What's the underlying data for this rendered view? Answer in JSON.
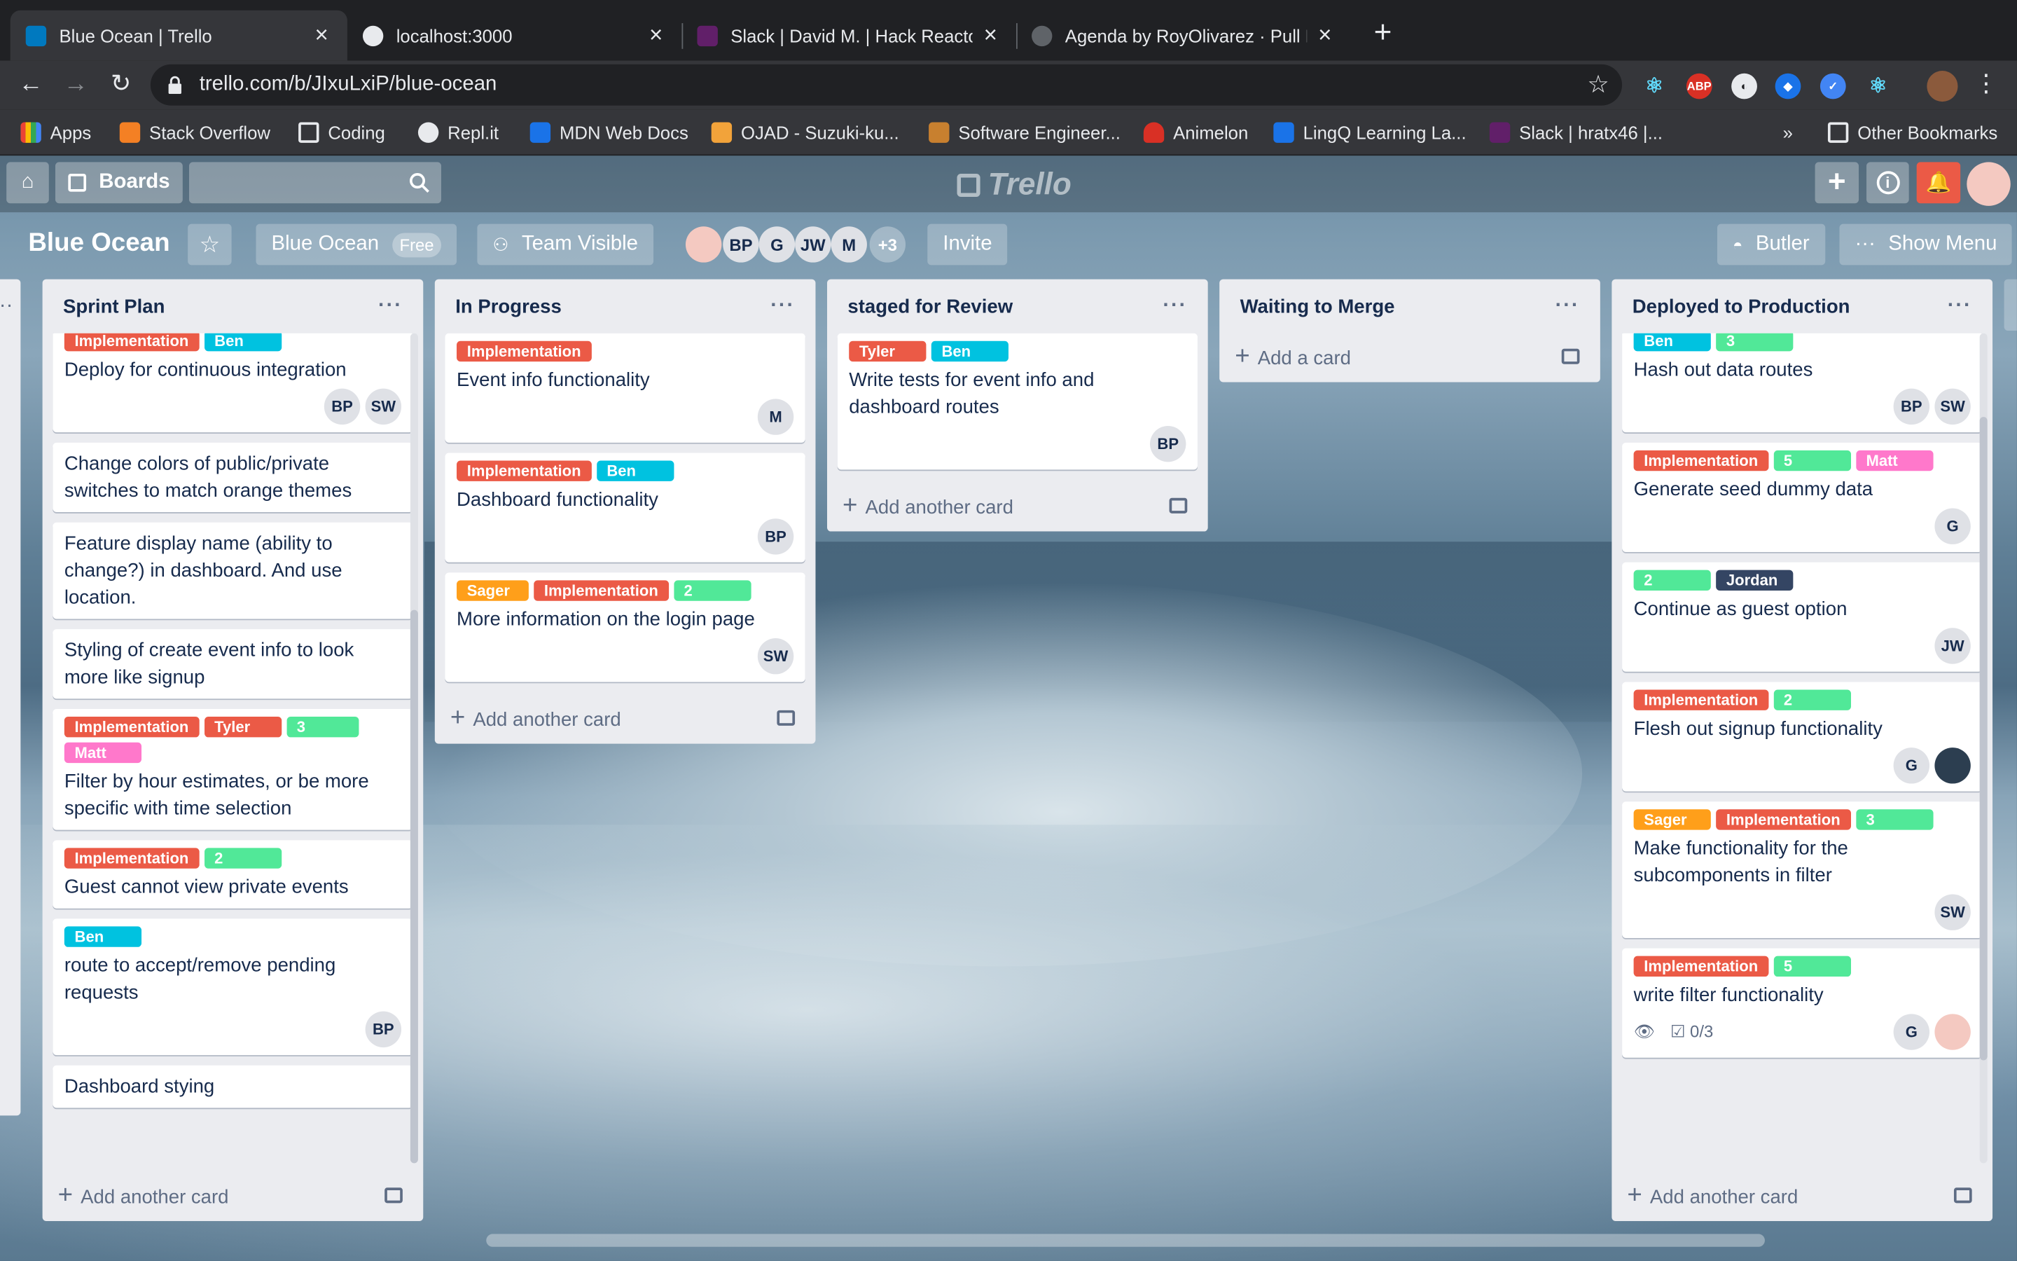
{
  "browser": {
    "tabs": [
      {
        "title": "Blue Ocean | Trello",
        "icon": "trello-icon"
      },
      {
        "title": "localhost:3000",
        "icon": "globe-icon"
      },
      {
        "title": "Slack | David M. | Hack Reactor",
        "icon": "slack-icon"
      },
      {
        "title": "Agenda by RoyOlivarez · Pull Requ",
        "icon": "github-icon"
      }
    ],
    "url": "trello.com/b/JIxuLxiP/blue-ocean",
    "bookmarks": [
      "Apps",
      "Stack Overflow",
      "Coding",
      "Repl.it",
      "MDN Web Docs",
      "OJAD - Suzuki-ku...",
      "Software Engineer...",
      "Animelon",
      "LingQ Learning La...",
      "Slack | hratx46 |...",
      "»",
      "Other Bookmarks"
    ]
  },
  "colors": {
    "red": "#eb5a46",
    "blue": "#00c2e0",
    "green": "#61bd4f",
    "mint": "#51e898",
    "orange": "#ff9f1a",
    "pink": "#ff78cb",
    "navy": "#344563"
  },
  "header": {
    "boards_label": "Boards",
    "logo": "Trello"
  },
  "board": {
    "title": "Blue Ocean",
    "team": "Blue Ocean",
    "team_badge": "Free",
    "visibility": "Team Visible",
    "members": [
      "BP",
      "G",
      "JW",
      "M"
    ],
    "more_members": "+3",
    "invite": "Invite",
    "butler": "Butler",
    "show_menu": "Show Menu"
  },
  "lists": [
    {
      "title": "Sprint Plan",
      "add": "Add another card",
      "cards": [
        {
          "labels": [
            {
              "t": "Implementation",
              "c": "#eb5a46"
            },
            {
              "t": "Ben",
              "c": "#00c2e0"
            }
          ],
          "text": "Deploy for continuous integration",
          "members": [
            "BP",
            "SW"
          ]
        },
        {
          "labels": [],
          "text": "Change colors of public/private switches to match orange themes",
          "members": []
        },
        {
          "labels": [],
          "text": "Feature display name (ability to change?) in dashboard. And use location.",
          "members": []
        },
        {
          "labels": [],
          "text": "Styling of create event info to look more like signup",
          "members": []
        },
        {
          "labels": [
            {
              "t": "Implementation",
              "c": "#eb5a46"
            },
            {
              "t": "Tyler",
              "c": "#eb5a46"
            },
            {
              "t": "3",
              "c": "#51e898"
            },
            {
              "t": "Matt",
              "c": "#ff78cb"
            }
          ],
          "text": "Filter by hour estimates, or be more specific with time selection",
          "members": []
        },
        {
          "labels": [
            {
              "t": "Implementation",
              "c": "#eb5a46"
            },
            {
              "t": "2",
              "c": "#51e898"
            }
          ],
          "text": "Guest cannot view private events",
          "members": []
        },
        {
          "labels": [
            {
              "t": "Ben",
              "c": "#00c2e0"
            }
          ],
          "text": "route to accept/remove pending requests",
          "members": [
            "BP"
          ]
        },
        {
          "labels": [],
          "text": "Dashboard stying",
          "members": []
        }
      ]
    },
    {
      "title": "In Progress",
      "add": "Add another card",
      "cards": [
        {
          "labels": [
            {
              "t": "Implementation",
              "c": "#eb5a46"
            }
          ],
          "text": "Event info functionality",
          "members": [
            "M"
          ]
        },
        {
          "labels": [
            {
              "t": "Implementation",
              "c": "#eb5a46"
            },
            {
              "t": "Ben",
              "c": "#00c2e0"
            }
          ],
          "text": "Dashboard functionality",
          "members": [
            "BP"
          ]
        },
        {
          "labels": [
            {
              "t": "Sager",
              "c": "#ff9f1a"
            },
            {
              "t": "Implementation",
              "c": "#eb5a46"
            },
            {
              "t": "2",
              "c": "#51e898"
            }
          ],
          "text": "More information on the login page",
          "members": [
            "SW"
          ]
        }
      ]
    },
    {
      "title": "staged for Review",
      "add": "Add another card",
      "cards": [
        {
          "labels": [
            {
              "t": "Tyler",
              "c": "#eb5a46"
            },
            {
              "t": "Ben",
              "c": "#00c2e0"
            }
          ],
          "text": "Write tests for event info and dashboard routes",
          "members": [
            "BP"
          ]
        }
      ]
    },
    {
      "title": "Waiting to Merge",
      "add": "Add a card",
      "cards": []
    },
    {
      "title": "Deployed to Production",
      "add": "Add another card",
      "cards": [
        {
          "labels": [
            {
              "t": "Ben",
              "c": "#00c2e0"
            },
            {
              "t": "3",
              "c": "#51e898"
            }
          ],
          "text": "Hash out data routes",
          "members": [
            "BP",
            "SW"
          ]
        },
        {
          "labels": [
            {
              "t": "Implementation",
              "c": "#eb5a46"
            },
            {
              "t": "5",
              "c": "#51e898"
            },
            {
              "t": "Matt",
              "c": "#ff78cb"
            }
          ],
          "text": "Generate seed dummy data",
          "members": [
            "G"
          ]
        },
        {
          "labels": [
            {
              "t": "2",
              "c": "#51e898"
            },
            {
              "t": "Jordan",
              "c": "#344563"
            }
          ],
          "text": "Continue as guest option",
          "members": [
            "JW"
          ]
        },
        {
          "labels": [
            {
              "t": "Implementation",
              "c": "#eb5a46"
            },
            {
              "t": "2",
              "c": "#51e898"
            }
          ],
          "text": "Flesh out signup functionality",
          "members": [
            "G",
            "photo"
          ]
        },
        {
          "labels": [
            {
              "t": "Sager",
              "c": "#ff9f1a"
            },
            {
              "t": "Implementation",
              "c": "#eb5a46"
            },
            {
              "t": "3",
              "c": "#51e898"
            }
          ],
          "text": "Make functionality for the subcomponents in filter",
          "members": [
            "SW"
          ]
        },
        {
          "labels": [
            {
              "t": "Implementation",
              "c": "#eb5a46"
            },
            {
              "t": "5",
              "c": "#51e898"
            }
          ],
          "text": "write filter functionality",
          "members": [
            "G",
            "photo"
          ],
          "checklist": "0/3"
        }
      ]
    }
  ]
}
